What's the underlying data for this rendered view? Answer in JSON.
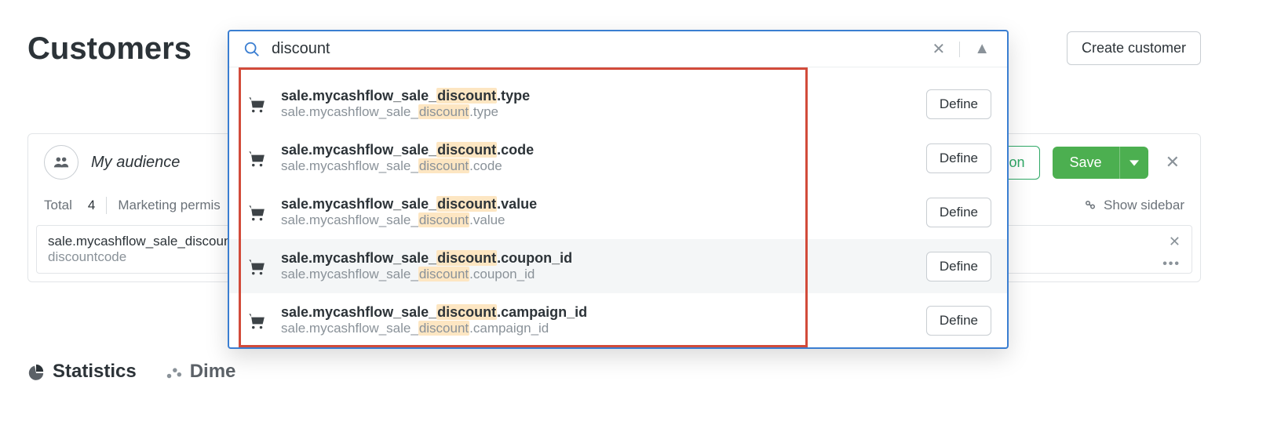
{
  "page": {
    "title": "Customers",
    "create_button": "Create customer"
  },
  "search": {
    "value": "discount",
    "close_title": "Close",
    "collapse_title": "Collapse",
    "highlight": "discount",
    "define_label": "Define",
    "results": [
      {
        "title_prefix": "sale.mycashflow_sale_",
        "title_suffix": ".type",
        "sub_prefix": "sale.mycashflow_sale_",
        "sub_suffix": ".type",
        "hovered": false
      },
      {
        "title_prefix": "sale.mycashflow_sale_",
        "title_suffix": ".code",
        "sub_prefix": "sale.mycashflow_sale_",
        "sub_suffix": ".code",
        "hovered": false
      },
      {
        "title_prefix": "sale.mycashflow_sale_",
        "title_suffix": ".value",
        "sub_prefix": "sale.mycashflow_sale_",
        "sub_suffix": ".value",
        "hovered": false
      },
      {
        "title_prefix": "sale.mycashflow_sale_",
        "title_suffix": ".coupon_id",
        "sub_prefix": "sale.mycashflow_sale_",
        "sub_suffix": ".coupon_id",
        "hovered": true
      },
      {
        "title_prefix": "sale.mycashflow_sale_",
        "title_suffix": ".campaign_id",
        "sub_prefix": "sale.mycashflow_sale_",
        "sub_suffix": ".campaign_id",
        "hovered": false
      }
    ]
  },
  "audience": {
    "name": "My audience",
    "choose_action": "e action",
    "save": "Save",
    "total_label": "Total",
    "total_value": "4",
    "marketing_label": "Marketing permis",
    "show_sidebar": "Show sidebar"
  },
  "filter": {
    "title": "sale.mycashflow_sale_discoun",
    "value": "discountcode"
  },
  "tabs": {
    "statistics": "Statistics",
    "dimensions": "Dime"
  }
}
